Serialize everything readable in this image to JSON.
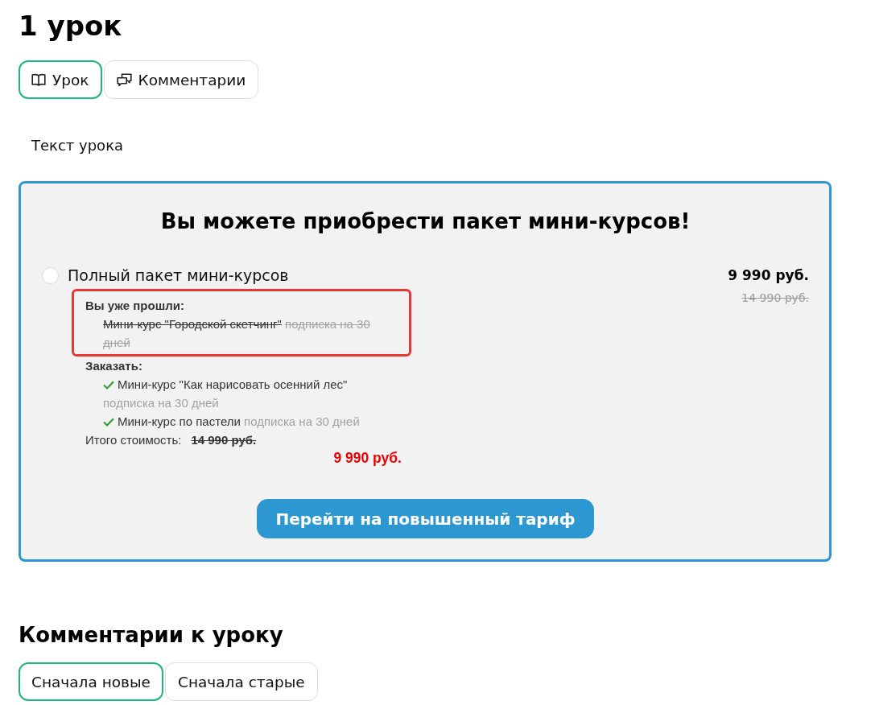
{
  "page": {
    "title": "1 урок"
  },
  "tabs": [
    {
      "label": "Урок",
      "kind": "lesson",
      "selected": true
    },
    {
      "label": "Комментарии",
      "kind": "comments",
      "selected": false
    }
  ],
  "lesson": {
    "text": "Текст урока"
  },
  "offer": {
    "title": "Вы можете приобрести пакет мини-курсов!",
    "packages": [
      {
        "label": "Полный пакет мини-курсов",
        "selected": false,
        "price": "9 990 руб.",
        "old_price": "14 990 руб.",
        "completed": {
          "heading": "Вы уже прошли:",
          "highlighted": true,
          "items": [
            {
              "name": "Мини-курс \"Городской скетчинг\"",
              "term": "подписка на 30 дней"
            }
          ]
        },
        "order": {
          "heading": "Заказать:",
          "items": [
            {
              "name": "Мини-курс \"Как нарисовать осенний лес\"",
              "term": "подписка на 30 дней",
              "checked": true
            },
            {
              "name": "Мини-курс по пастели",
              "term": "подписка на 30 дней",
              "checked": true
            }
          ]
        },
        "total": {
          "label": "Итого стоимость:",
          "old_price": "14 990 руб.",
          "price": "9 990 руб."
        }
      }
    ],
    "button": "Перейти на повышенный тариф"
  },
  "comments": {
    "title": "Комментарии к уроку",
    "sort_tabs": [
      {
        "label": "Сначала новые",
        "selected": true
      },
      {
        "label": "Сначала старые",
        "selected": false
      }
    ]
  }
}
